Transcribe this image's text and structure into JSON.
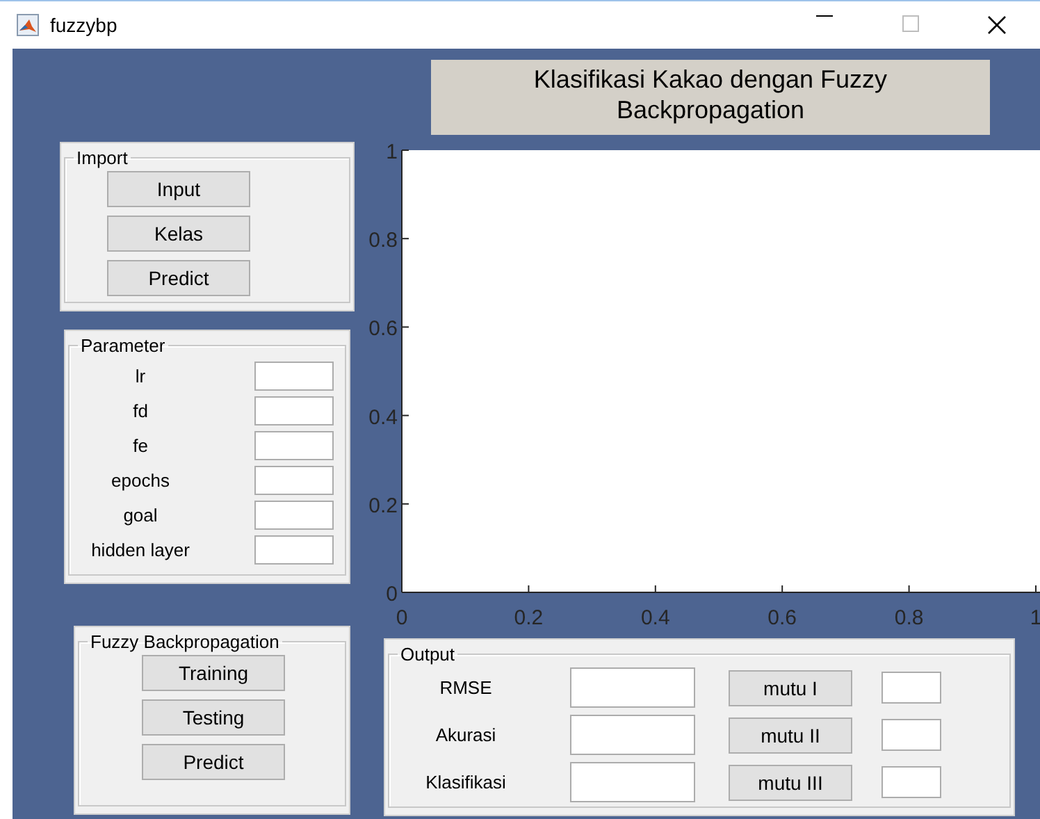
{
  "window": {
    "title": "fuzzybp"
  },
  "heading": "Klasifikasi Kakao dengan Fuzzy Backpropagation",
  "import_panel": {
    "title": "Import",
    "buttons": [
      "Input",
      "Kelas",
      "Predict"
    ]
  },
  "parameter_panel": {
    "title": "Parameter",
    "fields": [
      {
        "label": "lr"
      },
      {
        "label": "fd"
      },
      {
        "label": "fe"
      },
      {
        "label": "epochs"
      },
      {
        "label": "goal"
      },
      {
        "label": "hidden layer"
      }
    ]
  },
  "axes": {
    "chart_data": {
      "type": "line",
      "xlim": [
        0,
        1
      ],
      "ylim": [
        0,
        1
      ],
      "xticks": [
        0,
        0.2,
        0.4,
        0.6,
        0.8,
        1
      ],
      "yticks": [
        0,
        0.2,
        0.4,
        0.6,
        0.8,
        1
      ]
    }
  },
  "fuzzy_panel": {
    "title": "Fuzzy Backpropagation",
    "buttons": [
      "Training",
      "Testing",
      "Predict"
    ]
  },
  "output_panel": {
    "title": "Output",
    "fields": [
      {
        "label": "RMSE"
      },
      {
        "label": "Akurasi"
      },
      {
        "label": "Klasifikasi"
      }
    ],
    "class_buttons": [
      "mutu I",
      "mutu II",
      "mutu III"
    ]
  }
}
